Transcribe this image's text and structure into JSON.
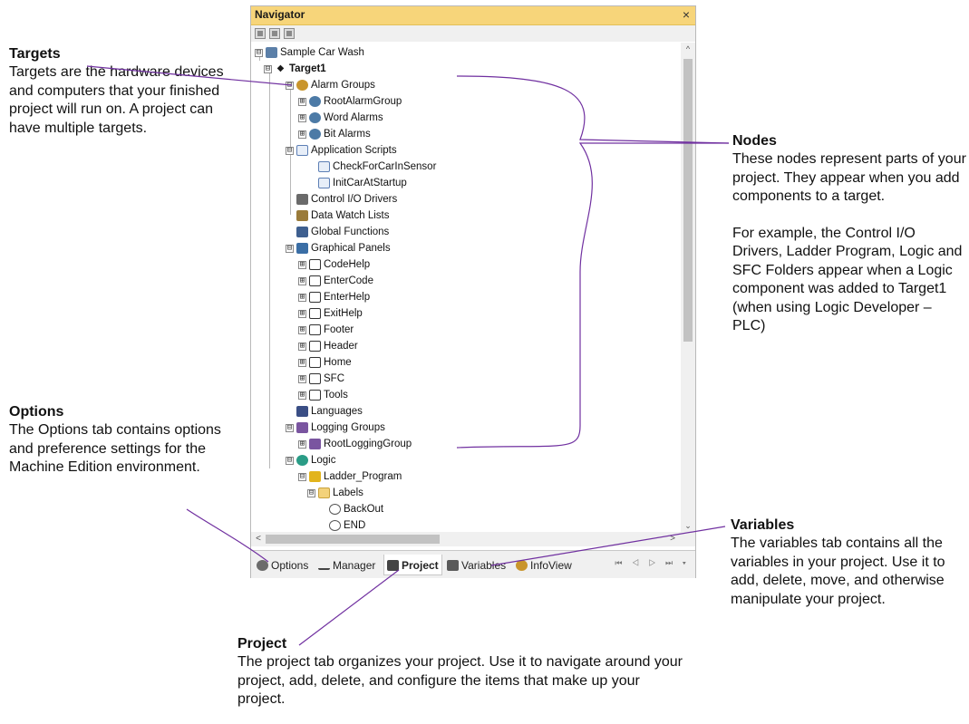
{
  "navigator": {
    "title": "Navigator",
    "close_glyph": "×",
    "tree": [
      {
        "label": "Sample Car Wash",
        "icon": "car-wash-icon",
        "expander": "⊟"
      },
      {
        "label": "Target1",
        "icon": "target-icon",
        "expander": "⊟",
        "bold": true
      },
      {
        "label": "Alarm Groups",
        "icon": "alarm-groups-icon",
        "expander": "⊟"
      },
      {
        "label": "RootAlarmGroup",
        "icon": "alarm-icon",
        "expander": "⊞"
      },
      {
        "label": "Word Alarms",
        "icon": "alarm-icon",
        "expander": "⊞"
      },
      {
        "label": "Bit Alarms",
        "icon": "alarm-icon",
        "expander": "⊞"
      },
      {
        "label": "Application Scripts",
        "icon": "scripts-icon",
        "expander": "⊟"
      },
      {
        "label": "CheckForCarInSensor",
        "icon": "script-icon"
      },
      {
        "label": "InitCarAtStartup",
        "icon": "script-icon"
      },
      {
        "label": "Control I/O Drivers",
        "icon": "io-drivers-icon"
      },
      {
        "label": "Data Watch Lists",
        "icon": "watch-list-icon"
      },
      {
        "label": "Global Functions",
        "icon": "functions-icon"
      },
      {
        "label": "Graphical Panels",
        "icon": "panels-icon",
        "expander": "⊟"
      },
      {
        "label": "CodeHelp",
        "icon": "panel-icon",
        "expander": "⊞"
      },
      {
        "label": "EnterCode",
        "icon": "panel-icon",
        "expander": "⊞"
      },
      {
        "label": "EnterHelp",
        "icon": "panel-icon",
        "expander": "⊞"
      },
      {
        "label": "ExitHelp",
        "icon": "panel-icon",
        "expander": "⊞"
      },
      {
        "label": "Footer",
        "icon": "panel-icon",
        "expander": "⊞"
      },
      {
        "label": "Header",
        "icon": "panel-icon",
        "expander": "⊞"
      },
      {
        "label": "Home",
        "icon": "panel-icon",
        "expander": "⊞"
      },
      {
        "label": "SFC",
        "icon": "panel-icon",
        "expander": "⊞"
      },
      {
        "label": "Tools",
        "icon": "panel-icon",
        "expander": "⊞"
      },
      {
        "label": "Languages",
        "icon": "languages-icon"
      },
      {
        "label": "Logging Groups",
        "icon": "logging-groups-icon",
        "expander": "⊟"
      },
      {
        "label": "RootLoggingGroup",
        "icon": "logging-icon",
        "expander": "⊞"
      },
      {
        "label": "Logic",
        "icon": "logic-icon",
        "expander": "⊟"
      },
      {
        "label": "Ladder_Program",
        "icon": "ladder-icon",
        "expander": "⊟"
      },
      {
        "label": "Labels",
        "icon": "folder-icon",
        "expander": "⊟"
      },
      {
        "label": "BackOut",
        "icon": "label-icon"
      },
      {
        "label": "END",
        "icon": "label-icon"
      }
    ],
    "tabs": [
      {
        "label": "Options",
        "icon": "gear-icon"
      },
      {
        "label": "Manager",
        "icon": "manager-icon"
      },
      {
        "label": "Project",
        "icon": "project-icon",
        "active": true
      },
      {
        "label": "Variables",
        "icon": "variables-icon"
      },
      {
        "label": "InfoView",
        "icon": "infoview-icon"
      }
    ],
    "tab_nav": "⏮ ◁ ▷ ⏭ ▾",
    "scroll": {
      "up": "^",
      "down": "⌄",
      "left": "<",
      "right": ">"
    }
  },
  "callouts": {
    "targets": {
      "title": "Targets",
      "body": "Targets are the hardware devices and computers that your finished project will run on. A project can have multiple targets."
    },
    "nodes": {
      "title": "Nodes",
      "body": "These nodes represent parts of your project. They appear when you add components to a target.",
      "body2": "For example, the Control I/O Drivers, Ladder Program, Logic and SFC Folders appear when a Logic component was added to Target1 (when using Logic Developer – PLC)"
    },
    "options": {
      "title": "Options",
      "body": "The Options tab contains options and preference settings for the Machine Edition environment."
    },
    "variables": {
      "title": "Variables",
      "body": "The variables tab contains all the variables in your project. Use it to add, delete, move, and otherwise manipulate your project."
    },
    "project": {
      "title": "Project",
      "body": "The project tab organizes your project. Use it to navigate around your project, add, delete, and configure the items that make up your project."
    }
  },
  "colors": {
    "title_bar": "#f7d57a",
    "connector": "#7030a0"
  }
}
